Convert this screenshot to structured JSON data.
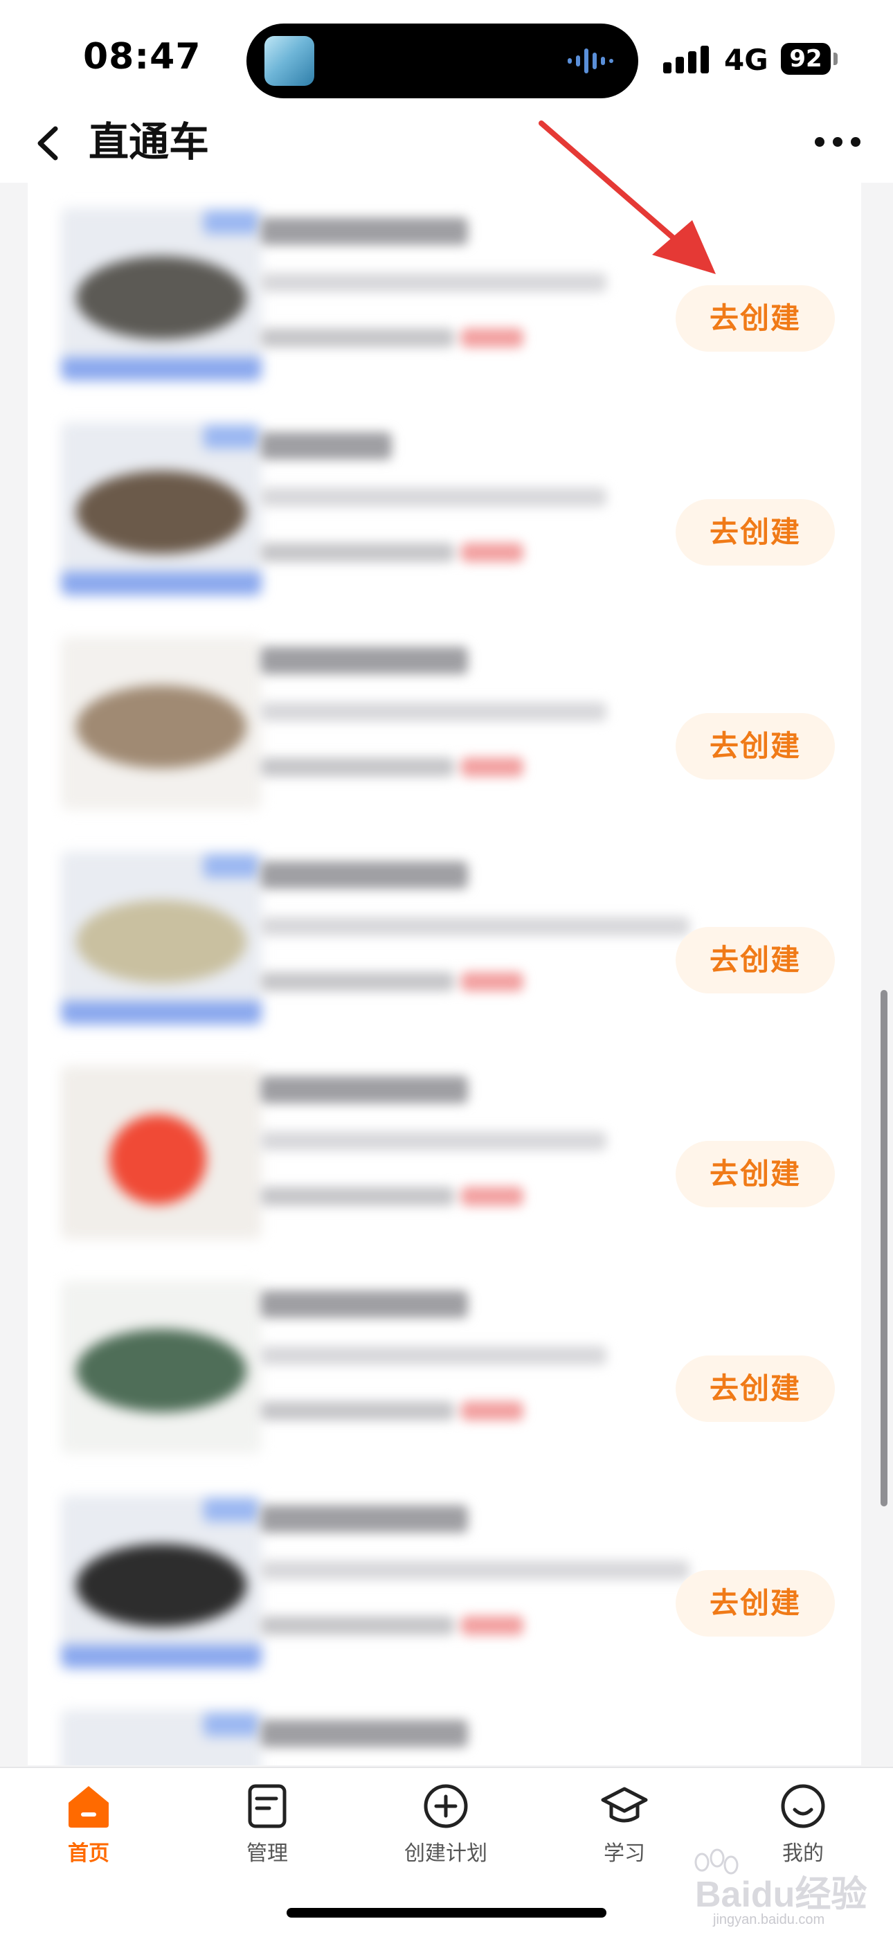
{
  "status_bar": {
    "time": "08:47",
    "network": "4G",
    "battery": "92"
  },
  "nav": {
    "back_icon": "chevron-left-icon",
    "title": "直通车",
    "more_icon": "more-dots-icon"
  },
  "list": {
    "items": [
      {
        "button": "去创建",
        "thumb_color": "#5c5a55"
      },
      {
        "button": "去创建",
        "thumb_color": "#6b5a4a"
      },
      {
        "button": "去创建",
        "thumb_color": "#a08a73"
      },
      {
        "button": "去创建",
        "thumb_color": "#c9c0a0"
      },
      {
        "button": "去创建",
        "thumb_color": "#f04a36"
      },
      {
        "button": "去创建",
        "thumb_color": "#4f6e58"
      },
      {
        "button": "去创建",
        "thumb_color": "#2d2d2d"
      }
    ]
  },
  "tab_bar": {
    "tabs": [
      {
        "label": "首页",
        "icon": "home-icon",
        "active": true
      },
      {
        "label": "管理",
        "icon": "document-icon",
        "active": false
      },
      {
        "label": "创建计划",
        "icon": "plus-circle-icon",
        "active": false
      },
      {
        "label": "学习",
        "icon": "graduation-cap-icon",
        "active": false
      },
      {
        "label": "我的",
        "icon": "smiley-icon",
        "active": false
      }
    ]
  },
  "watermark": {
    "text": "Baidu经验",
    "sub": "jingyan.baidu.com"
  },
  "colors": {
    "accent": "#ff6a00",
    "button_text": "#f07a17",
    "button_bg": "#fff5ea",
    "annotation": "#e53935"
  }
}
